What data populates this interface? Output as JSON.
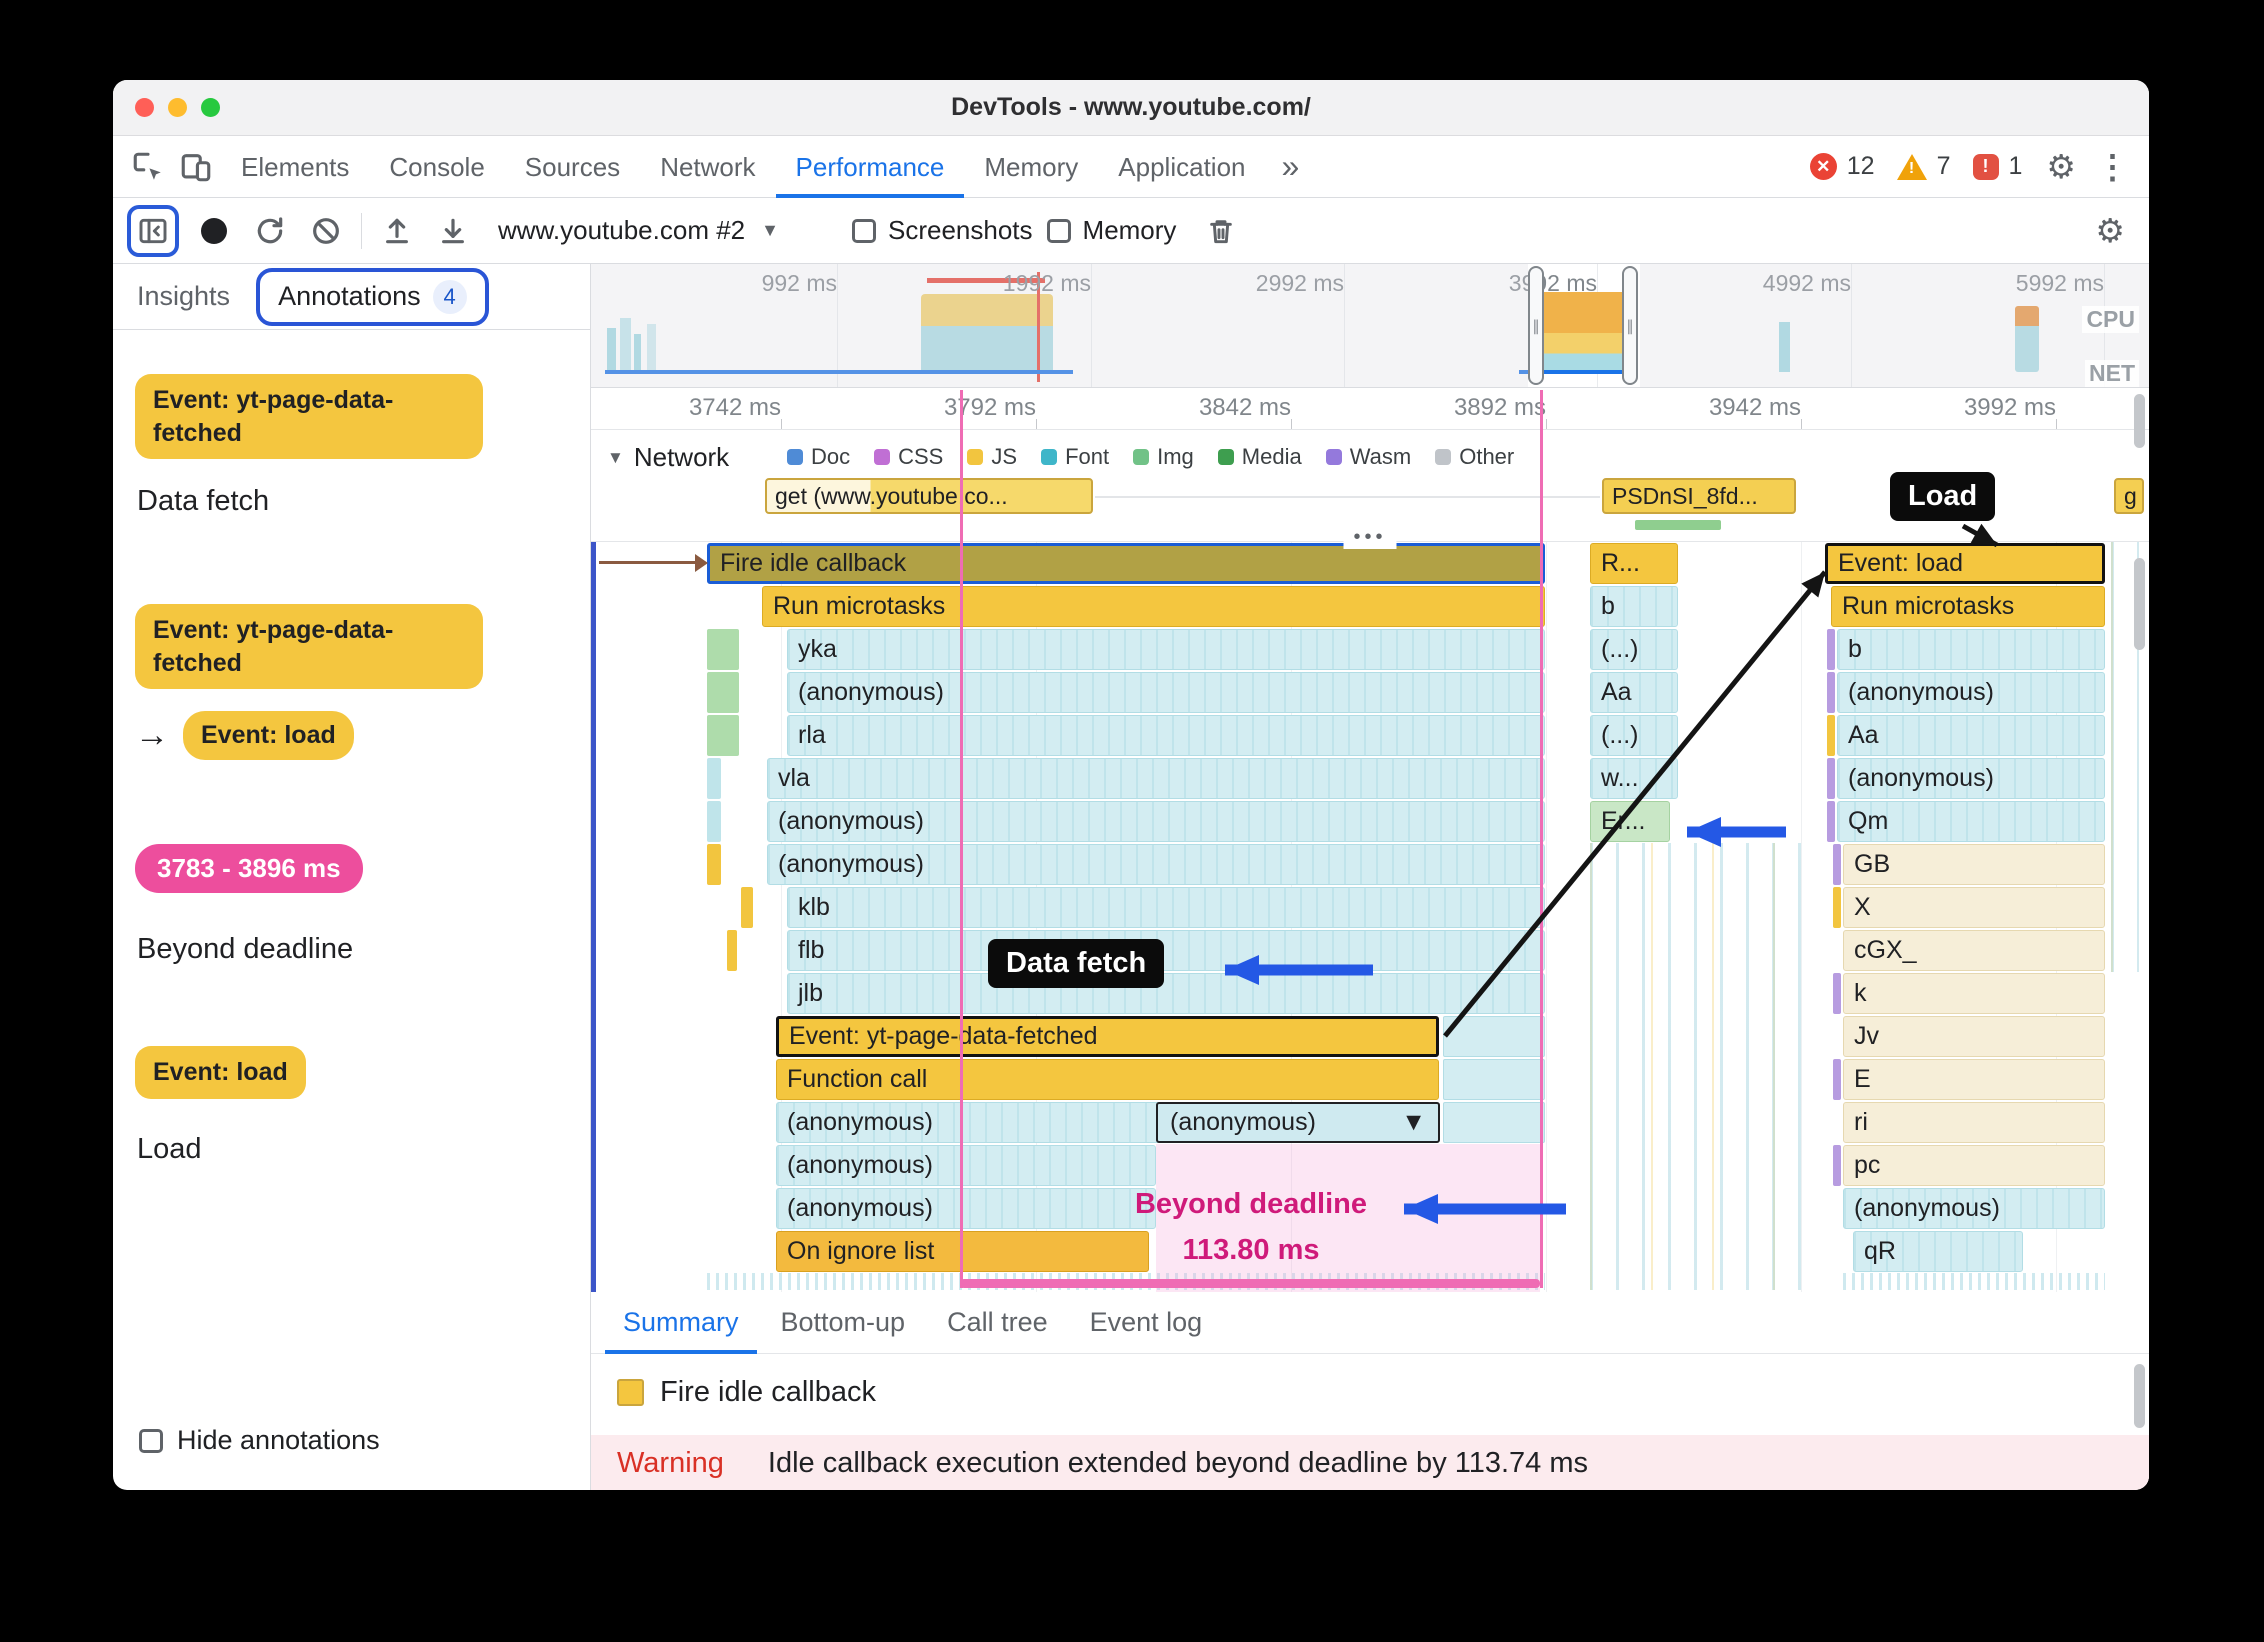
{
  "icons": {
    "cross": "✕",
    "exclaim": "!",
    "more_tabs": "»",
    "kebab": "⋮",
    "gear": "⚙",
    "dropdown_caret": "▼",
    "disclosure_caret": "▼",
    "arrow_right": "→",
    "overview_handle": "∥",
    "dots": "•••"
  },
  "colors": {
    "accent_blue": "#1a73e8",
    "annotation_yellow": "#f4c63f",
    "annotation_pink": "#ed4e9d",
    "deadline_pink": "#cf1a7a",
    "arrow_blue": "#2458e5"
  },
  "titlebar": {
    "title": "DevTools - www.youtube.com/"
  },
  "tabs": {
    "items": [
      "Elements",
      "Console",
      "Sources",
      "Network",
      "Performance",
      "Memory",
      "Application"
    ],
    "active": "Performance",
    "error_count": "12",
    "warning_count": "7",
    "issue_count": "1"
  },
  "toolbar": {
    "profile_select": "www.youtube.com #2",
    "screenshots_label": "Screenshots",
    "memory_label": "Memory"
  },
  "sidebar": {
    "insights_label": "Insights",
    "annotations_label": "Annotations",
    "annotations_count": "4",
    "entries": [
      {
        "pill": "Event: yt-page-data-fetched",
        "desc": "Data fetch"
      },
      {
        "pill": "Event: yt-page-data-fetched",
        "linked_pill": "Event: load"
      },
      {
        "pill": "3783 - 3896 ms",
        "desc": "Beyond deadline"
      },
      {
        "pill": "Event: load",
        "desc": "Load"
      }
    ],
    "hide_label": "Hide annotations"
  },
  "overview": {
    "time_labels": [
      "992 ms",
      "1992 ms",
      "2992 ms",
      "3992 ms",
      "4992 ms",
      "5992 ms"
    ],
    "cpu_label": "CPU",
    "net_label": "NET"
  },
  "ruler": {
    "labels": [
      "3742 ms",
      "3792 ms",
      "3842 ms",
      "3892 ms",
      "3942 ms",
      "3992 ms"
    ]
  },
  "network": {
    "track_label": "Network",
    "legend": [
      {
        "label": "Doc",
        "color": "#4f8bd6"
      },
      {
        "label": "CSS",
        "color": "#c06fd4"
      },
      {
        "label": "JS",
        "color": "#f2c53f"
      },
      {
        "label": "Font",
        "color": "#3fb6c9"
      },
      {
        "label": "Img",
        "color": "#71c287"
      },
      {
        "label": "Media",
        "color": "#3e9e4f"
      },
      {
        "label": "Wasm",
        "color": "#9479dc"
      },
      {
        "label": "Other",
        "color": "#c0c4c9"
      }
    ],
    "requests": [
      {
        "label": "get (www.youtube.co..."
      },
      {
        "label": "PSDnSI_8fd..."
      },
      {
        "label": "g"
      }
    ]
  },
  "flame": {
    "left_rows": [
      "Fire idle callback",
      "Run microtasks",
      "yka",
      "(anonymous)",
      "rla",
      "vla",
      "(anonymous)",
      "(anonymous)",
      "klb",
      "flb",
      "jlb",
      "Event: yt-page-data-fetched",
      "Function call",
      "(anonymous)",
      "(anonymous)",
      "(anonymous)",
      "On ignore list"
    ],
    "mid_rows": [
      "R...",
      "b",
      "(...)",
      "Aa",
      "(...)",
      "w...",
      "Er..."
    ],
    "right_rows": [
      "Event: load",
      "Run microtasks",
      "b",
      "(anonymous)",
      "Aa",
      "(anonymous)",
      "Qm",
      "GB",
      "X",
      "cGX_",
      "k",
      "Jv",
      "E",
      "ri",
      "pc",
      "(anonymous)",
      "qR"
    ],
    "dropdown_label": "(anonymous)",
    "annotations": {
      "load_label": "Load",
      "data_fetch_label": "Data fetch",
      "beyond_line1": "Beyond deadline",
      "beyond_line2": "113.80 ms"
    }
  },
  "bottom": {
    "tabs": [
      "Summary",
      "Bottom-up",
      "Call tree",
      "Event log"
    ],
    "active": "Summary",
    "summary_item": "Fire idle callback",
    "warning_label": "Warning",
    "warning_text": "Idle callback execution extended beyond deadline by 113.74 ms"
  }
}
